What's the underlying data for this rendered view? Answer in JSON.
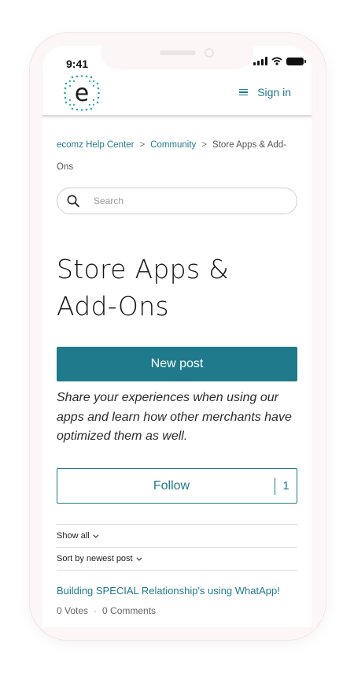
{
  "status": {
    "time": "9:41"
  },
  "header": {
    "logo_letter": "e",
    "signin_label": "Sign in"
  },
  "breadcrumb": {
    "items": [
      "ecomz Help Center",
      "Community",
      "Store Apps & Add-Ons"
    ],
    "separator": ">"
  },
  "search": {
    "placeholder": "Search"
  },
  "page": {
    "title_line1": "Store Apps &",
    "title_line2": "Add-Ons",
    "new_post_label": "New post",
    "description": "Share your experiences when using our apps and learn how other merchants have optimized them as well.",
    "follow_label": "Follow",
    "follow_count": "1"
  },
  "filters": {
    "show": "Show all",
    "sort": "Sort by newest post"
  },
  "posts": [
    {
      "title": "Building SPECIAL Relationship's using WhatApp!",
      "votes": "0 Votes",
      "comments": "0 Comments",
      "separator": "·"
    }
  ],
  "colors": {
    "accent": "#1f7a8c",
    "logo_teal": "#2aa8a8"
  },
  "icons": [
    "hamburger-icon",
    "search-icon",
    "chevron-down-icon",
    "signal-icon",
    "wifi-icon",
    "battery-icon"
  ]
}
